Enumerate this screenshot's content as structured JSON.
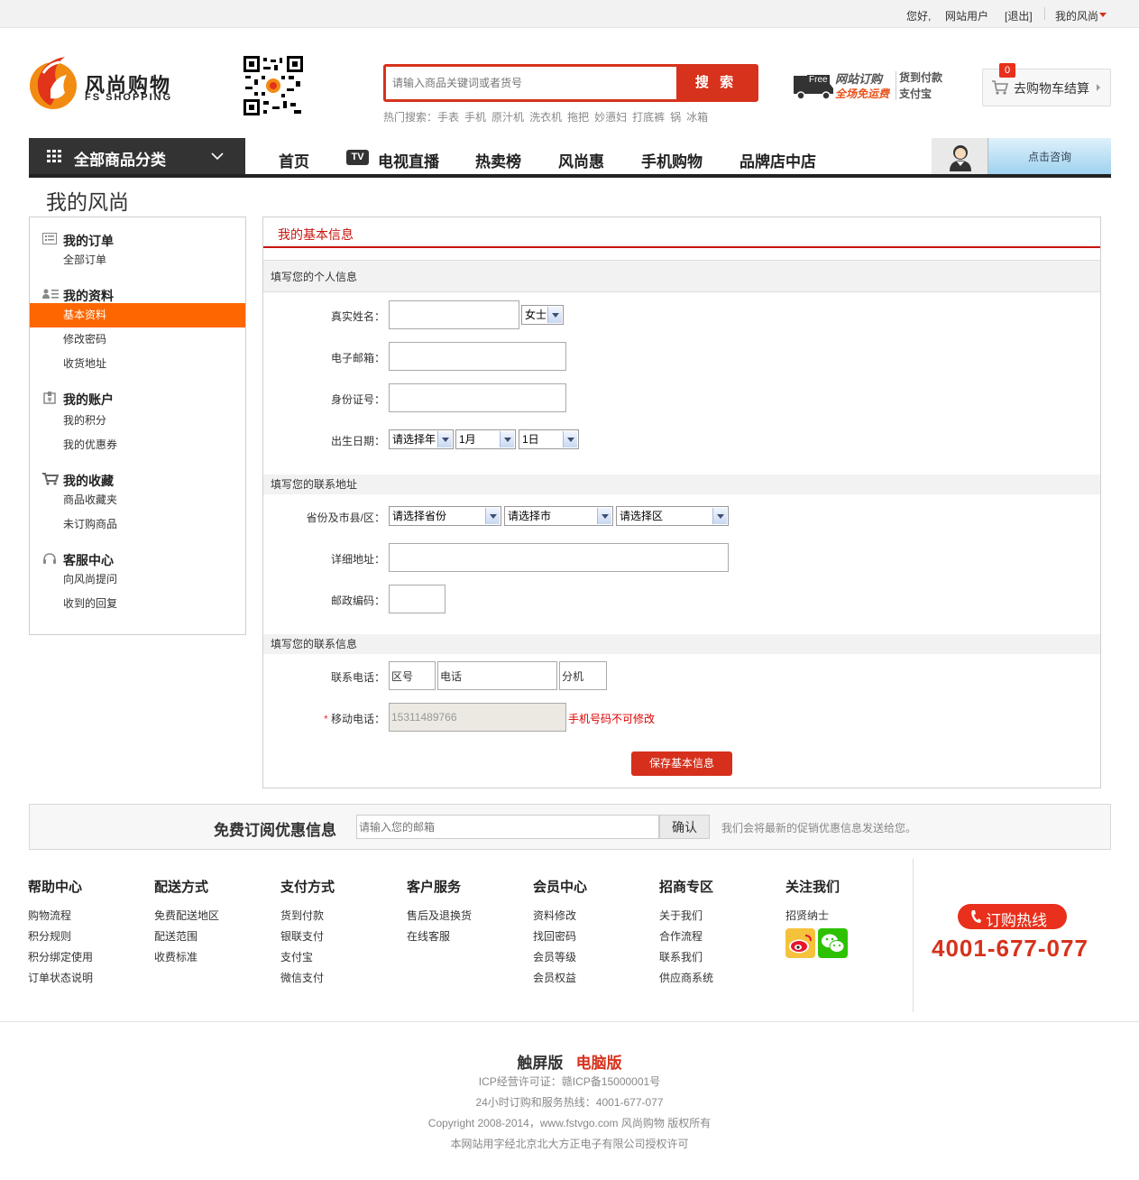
{
  "topbar": {
    "hello": "您好,",
    "user": "网站用户",
    "logout": "[退出]",
    "my": "我的风尚"
  },
  "header": {
    "logo_cn": "风尚购物",
    "logo_en": "FS SHOPPING",
    "search_placeholder": "请输入商品关键词或者货号",
    "search_btn": "搜 索",
    "hot_label": "热门搜索：",
    "hot_items": [
      "手表",
      "手机",
      "原汁机",
      "洗衣机",
      "拖把",
      "妙懑妇",
      "打底裤",
      "锅",
      "冰箱"
    ],
    "free_badge": "Free",
    "ship_line1": "网站订购",
    "ship_line2": "全场免运费",
    "pay_line1": "货到付款",
    "pay_line2": "支付宝",
    "cart_count": "0",
    "cart_label": "去购物车结算"
  },
  "nav": {
    "all_categories": "全部商品分类",
    "items": [
      "首页",
      "电视直播",
      "热卖榜",
      "风尚惠",
      "手机购物",
      "品牌店中店"
    ],
    "tv_badge": "TV",
    "consult": "点击咨询"
  },
  "page_title": "我的风尚",
  "sidebar": {
    "groups": [
      {
        "title": "我的订单",
        "items": [
          "全部订单"
        ]
      },
      {
        "title": "我的资料",
        "items": [
          "基本资料",
          "修改密码",
          "收货地址"
        ]
      },
      {
        "title": "我的账户",
        "items": [
          "我的积分",
          "我的优惠券"
        ]
      },
      {
        "title": "我的收藏",
        "items": [
          "商品收藏夹",
          "未订购商品"
        ]
      },
      {
        "title": "客服中心",
        "items": [
          "向风尚提问",
          "收到的回复"
        ]
      }
    ],
    "active_item": "基本资料"
  },
  "main": {
    "title": "我的基本信息",
    "sec_personal": "填写您的个人信息",
    "real_name_label": "真实姓名：",
    "gender_value": "女士",
    "email_label": "电子邮箱：",
    "id_label": "身份证号：",
    "birth_label": "出生日期：",
    "birth_year": "请选择年",
    "birth_month": "1月",
    "birth_day": "1日",
    "sec_address": "填写您的联系地址",
    "region_label": "省份及市县/区：",
    "province": "请选择省份",
    "city": "请选择市",
    "district": "请选择区",
    "detail_label": "详细地址：",
    "zip_label": "邮政编码：",
    "sec_contact": "填写您的联系信息",
    "phone_label": "联系电话：",
    "area_code": "区号",
    "phone": "电话",
    "ext": "分机",
    "mobile_star": "*",
    "mobile_label": "移动电话：",
    "mobile_value": "15311489766",
    "mobile_note": "手机号码不可修改",
    "save": "保存基本信息"
  },
  "subscribe": {
    "title": "免费订阅优惠信息",
    "placeholder": "请输入您的邮箱",
    "button": "确认",
    "note": "我们会将最新的促销优惠信息发送给您。"
  },
  "footer": {
    "columns": [
      {
        "title": "帮助中心",
        "links": [
          "购物流程",
          "积分规则",
          "积分绑定使用",
          "订单状态说明"
        ]
      },
      {
        "title": "配送方式",
        "links": [
          "免费配送地区",
          "配送范围",
          "收费标准"
        ]
      },
      {
        "title": "支付方式",
        "links": [
          "货到付款",
          "银联支付",
          "支付宝",
          "微信支付"
        ]
      },
      {
        "title": "客户服务",
        "links": [
          "售后及退换货",
          "在线客服"
        ]
      },
      {
        "title": "会员中心",
        "links": [
          "资料修改",
          "找回密码",
          "会员等级",
          "会员权益"
        ]
      },
      {
        "title": "招商专区",
        "links": [
          "关于我们",
          "合作流程",
          "联系我们",
          "供应商系统"
        ]
      },
      {
        "title": "关注我们",
        "links": [
          "招贤纳士"
        ]
      }
    ],
    "hotline_label": "订购热线",
    "hotline_number": "4001-677-077"
  },
  "bottom": {
    "touch": "触屏版",
    "pc": "电脑版",
    "icp": "ICP经营许可证：赣ICP备15000001号",
    "service": "24小时订购和服务热线：4001-677-077",
    "copyright": "Copyright 2008-2014，www.fstvgo.com 风尚购物 版权所有",
    "license": "本网站用字经北京北大方正电子有限公司授权许可"
  },
  "colors": {
    "brand_red": "#d6321c",
    "active_orange": "#fe6600",
    "nav_dark": "#333333"
  }
}
